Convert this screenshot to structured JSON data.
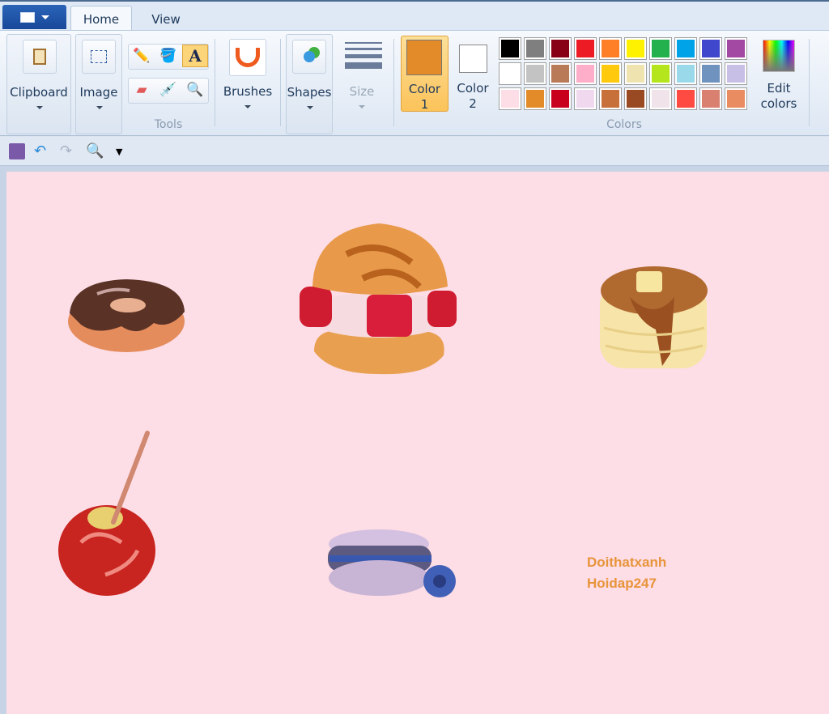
{
  "tabs": {
    "home": "Home",
    "view": "View"
  },
  "ribbon": {
    "clipboard": "Clipboard",
    "image": "Image",
    "tools_group": "Tools",
    "brushes": "Brushes",
    "shapes": "Shapes",
    "size": "Size",
    "color1": [
      "Color",
      "1"
    ],
    "color2": [
      "Color",
      "2"
    ],
    "edit_colors": [
      "Edit",
      "colors"
    ],
    "colors_group": "Colors",
    "color1_value": "#e38b28",
    "color2_value": "#ffffff",
    "active_tool": "text",
    "palette": [
      "#000000",
      "#7f7f7f",
      "#880015",
      "#ed1c24",
      "#ff7f27",
      "#fff200",
      "#22b14c",
      "#00a2e8",
      "#3f48cc",
      "#a349a4",
      "#ffffff",
      "#c3c3c3",
      "#b97a57",
      "#ffaec9",
      "#ffc90e",
      "#efe4b0",
      "#b5e61d",
      "#99d9ea",
      "#7092be",
      "#c8bfe7",
      "#fddde6",
      "#e38b28",
      "#c8001e",
      "#f0d8ef",
      "#c8703a",
      "#9a4a22",
      "#f0e4ea",
      "#ff4b41",
      "#d98070",
      "#e98c62"
    ]
  },
  "quick_access": [
    "save-icon",
    "undo-icon",
    "redo-icon",
    "zoom-icon",
    "customize-dropdown-icon"
  ],
  "canvas": {
    "background": "#fddde6",
    "text_lines": [
      "Doithatxanh",
      "Hoidap247"
    ],
    "text_color": "#e8943a",
    "drawings": [
      "donut",
      "cream-puff",
      "pancakes",
      "candy-apple",
      "macaron"
    ]
  }
}
